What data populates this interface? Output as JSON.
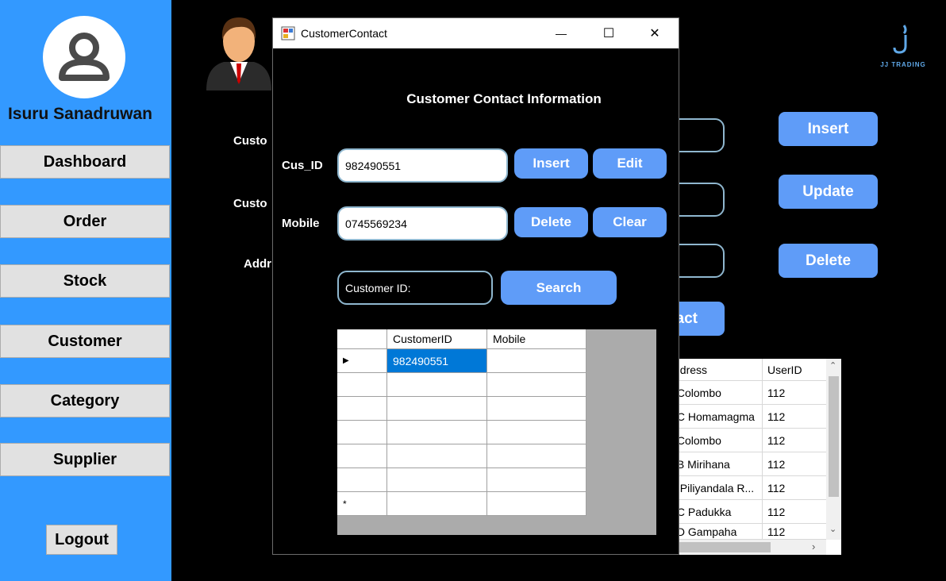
{
  "sidebar": {
    "user_name": "Isuru Sanadruwan",
    "nav": [
      "Dashboard",
      "Order",
      "Stock",
      "Customer",
      "Category",
      "Supplier"
    ],
    "logout": "Logout"
  },
  "main": {
    "labels": [
      "Custo",
      "Custo",
      "Addr"
    ],
    "buttons": {
      "insert": "Insert",
      "update": "Update",
      "delete": "Delete",
      "contact_partial": "act"
    },
    "logo_text": "JJ TRADING",
    "grid": {
      "headers": [
        "ddress",
        "UserID"
      ],
      "rows": [
        [
          "/Colombo",
          "112"
        ],
        [
          "/C Homamagma",
          "112"
        ],
        ".Colombo|112",
        [
          "/B Mirihana",
          "112"
        ],
        [
          ". Piliyandala R...",
          "112"
        ],
        [
          "/C Padukka",
          "112"
        ],
        [
          "/D Gampaha",
          "112"
        ]
      ]
    }
  },
  "dialog": {
    "title": "CustomerContact",
    "heading": "Customer Contact Information",
    "cus_id_label": "Cus_ID",
    "mobile_label": "Mobile",
    "cus_id_value": "982490551",
    "mobile_value": "0745569234",
    "search_value": "Customer ID:",
    "buttons": {
      "insert": "Insert",
      "edit": "Edit",
      "delete": "Delete",
      "clear": "Clear",
      "search": "Search"
    },
    "grid": {
      "headers": [
        "CustomerID",
        "Mobile"
      ],
      "rows": [
        [
          "982490551",
          ""
        ],
        [
          "",
          ""
        ],
        [
          "",
          ""
        ],
        [
          "",
          ""
        ],
        [
          "",
          ""
        ],
        [
          "",
          ""
        ]
      ],
      "new_row_marker": "*"
    },
    "controls": {
      "minimize": "—",
      "maximize": "☐",
      "close": "✕"
    }
  },
  "colors": {
    "sidebar": "#3399ff",
    "button_blue": "#5f9cf8",
    "selected_cell": "#0078d7"
  }
}
